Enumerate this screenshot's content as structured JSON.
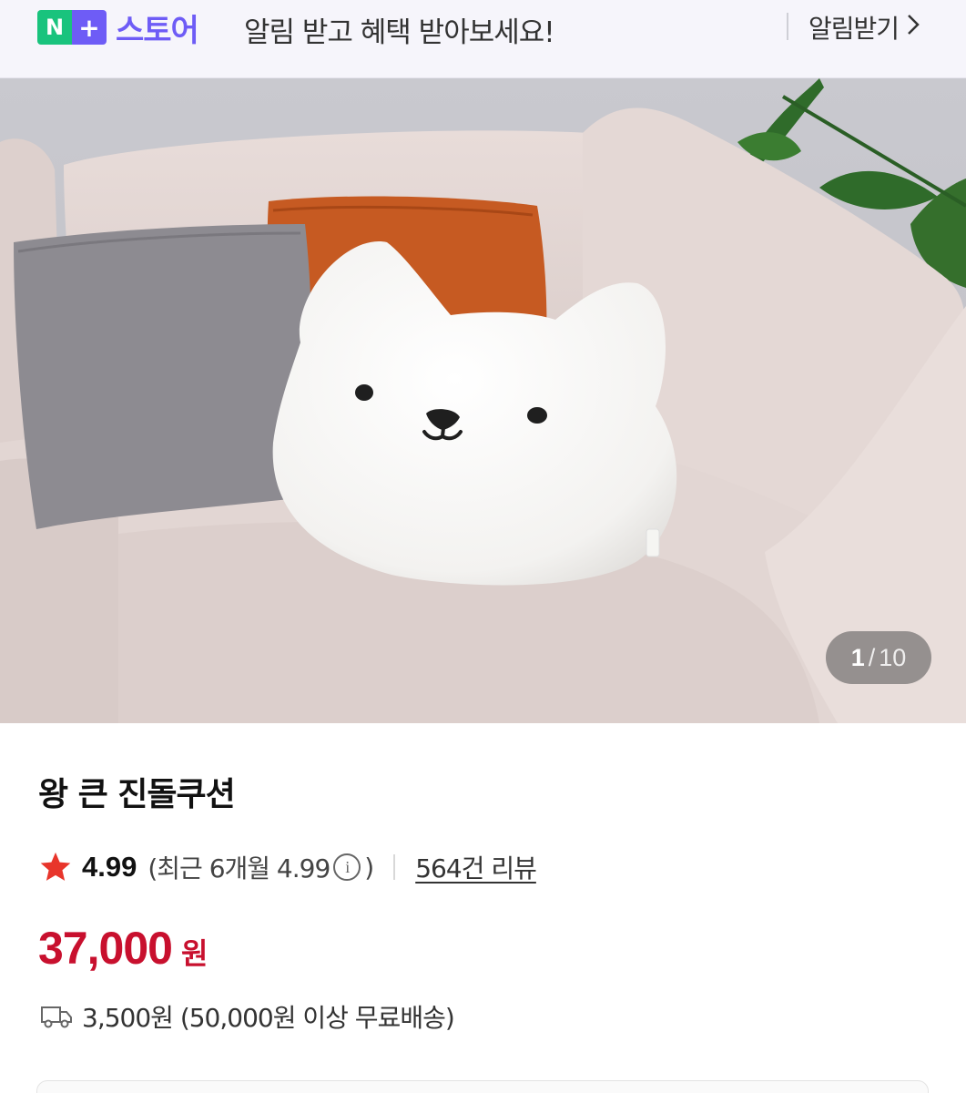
{
  "banner": {
    "logo_n": "N",
    "logo_plus": "+",
    "logo_text": "스토어",
    "message": "알림 받고 혜택 받아보세요!",
    "action_label": "알림받기"
  },
  "gallery": {
    "current": "1",
    "separator": "/",
    "total": "10"
  },
  "product": {
    "title": "왕 큰 진돌쿠션",
    "rating": "4.99",
    "recent_prefix": "(최근 6개월 4.99",
    "recent_suffix": ")",
    "info_glyph": "i",
    "review_link": "564건 리뷰",
    "price": "37,000",
    "currency": "원",
    "shipping": "3,500원 (50,000원 이상 무료배송)"
  },
  "colors": {
    "price": "#c8102e",
    "star": "#e8352b",
    "naver_green": "#19c37d",
    "naver_purple": "#6e5cf6"
  },
  "icons": {
    "chevron": "chevron-right-icon",
    "star": "star-icon",
    "info": "info-icon",
    "truck": "truck-icon"
  }
}
